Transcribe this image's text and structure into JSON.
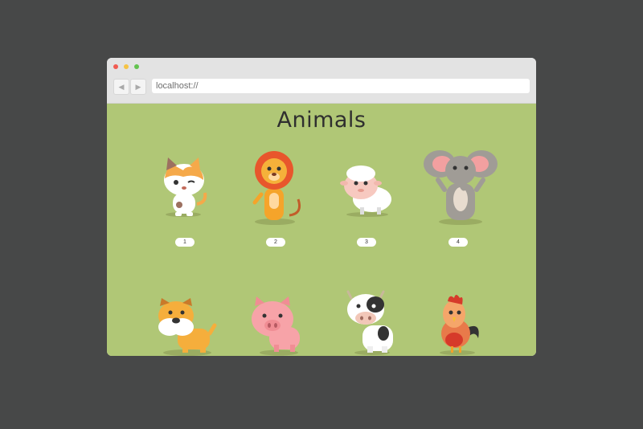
{
  "browser": {
    "url": "localhost://",
    "back_icon": "◀",
    "forward_icon": "▶"
  },
  "page": {
    "title": "Animals",
    "background": "#b0c776"
  },
  "animals": [
    {
      "name": "cat",
      "badge": "1"
    },
    {
      "name": "lion",
      "badge": "2"
    },
    {
      "name": "sheep",
      "badge": "3"
    },
    {
      "name": "elephant",
      "badge": "4"
    },
    {
      "name": "dog"
    },
    {
      "name": "pig"
    },
    {
      "name": "cow"
    },
    {
      "name": "rooster"
    }
  ]
}
